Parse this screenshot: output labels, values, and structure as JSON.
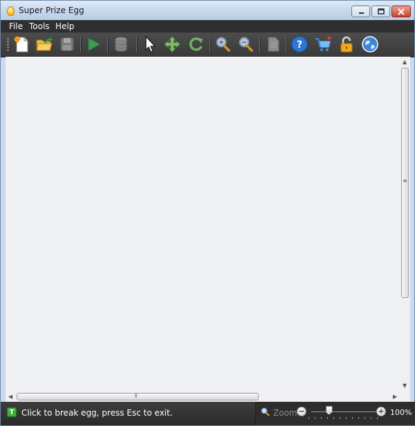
{
  "window": {
    "title": "Super Prize Egg",
    "controls": [
      "minimize",
      "maximize",
      "close"
    ]
  },
  "menu": [
    {
      "label": "File"
    },
    {
      "label": "Tools"
    },
    {
      "label": "Help"
    }
  ],
  "toolbar": {
    "buttons": [
      {
        "name": "new-icon"
      },
      {
        "name": "open-icon"
      },
      {
        "name": "save-icon"
      },
      {
        "name": "play-icon"
      },
      {
        "name": "database-icon"
      },
      {
        "name": "pointer-icon"
      },
      {
        "name": "move-icon"
      },
      {
        "name": "rotate-icon"
      },
      {
        "name": "zoom-in-icon"
      },
      {
        "name": "zoom-out-icon"
      },
      {
        "name": "document-icon"
      },
      {
        "name": "help-icon"
      },
      {
        "name": "cart-icon"
      },
      {
        "name": "unlock-icon"
      },
      {
        "name": "globe-icon"
      }
    ]
  },
  "status": {
    "icon": "t-icon",
    "text": "Click to break egg, press Esc to exit."
  },
  "zoom": {
    "label": "Zoom",
    "minus": "−",
    "plus": "+",
    "value": "100%",
    "slider_fraction": 0.3
  },
  "colors": {
    "menubar": "#2f2f2f",
    "toolbar": "#444444",
    "canvas": "#f0f1f4",
    "statusbar": "#333333"
  }
}
